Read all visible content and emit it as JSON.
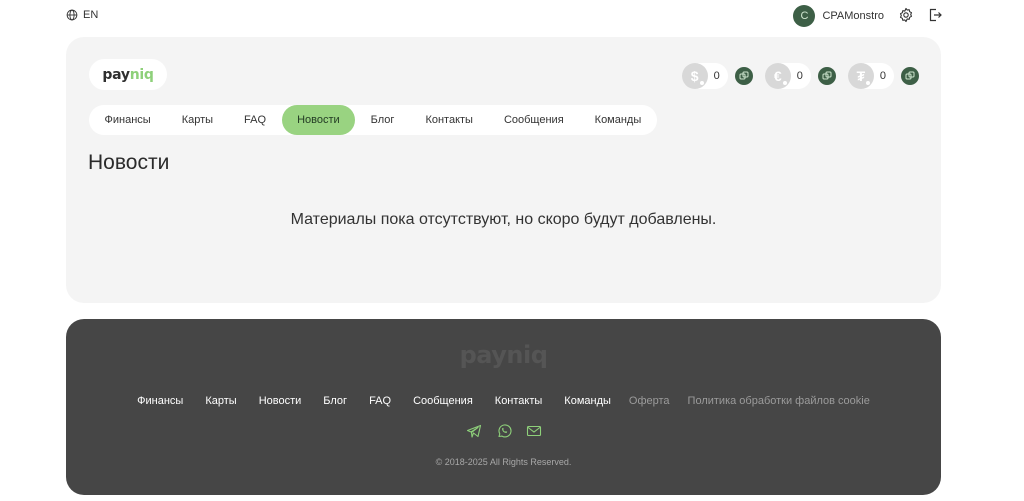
{
  "topbar": {
    "lang": "EN",
    "avatar_letter": "C",
    "username": "CPAMonstro"
  },
  "logo": {
    "part1": "pay",
    "part2": "niq"
  },
  "balances": [
    {
      "symbol": "$",
      "value": "0"
    },
    {
      "symbol": "€",
      "value": "0"
    },
    {
      "symbol": "₮",
      "value": "0"
    }
  ],
  "nav": {
    "items": [
      "Финансы",
      "Карты",
      "FAQ",
      "Новости",
      "Блог",
      "Контакты",
      "Сообщения",
      "Команды"
    ],
    "active": "Новости"
  },
  "page": {
    "title": "Новости",
    "empty_message": "Материалы пока отсутствуют, но скоро будут добавлены."
  },
  "footer": {
    "logo": "payniq",
    "links": [
      "Финансы",
      "Карты",
      "Новости",
      "Блог",
      "FAQ",
      "Сообщения",
      "Контакты",
      "Команды"
    ],
    "legal_links": [
      "Оферта",
      "Политика обработки файлов cookie"
    ],
    "copyright": "© 2018-2025 All Rights Reserved."
  },
  "colors": {
    "accent_green": "#99d381",
    "dark_green": "#3d5f46",
    "footer_bg": "#464646",
    "card_bg": "#f4f4f4"
  }
}
